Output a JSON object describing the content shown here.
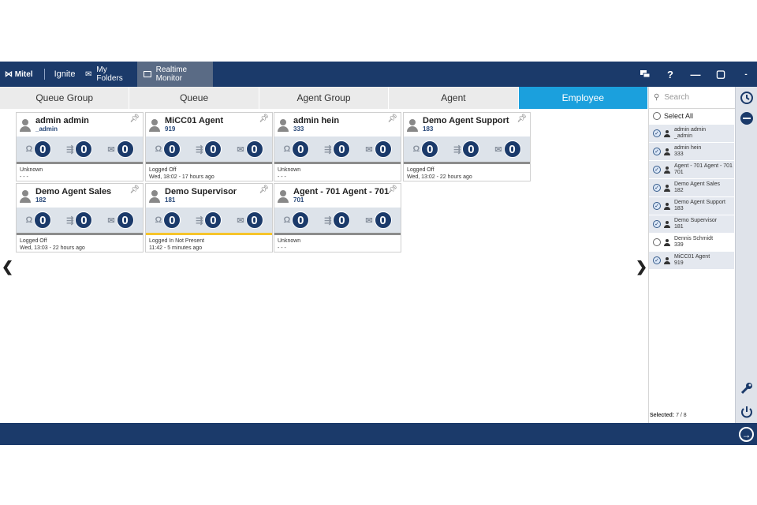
{
  "topbar": {
    "logo": "⋈ Mitel",
    "product": "Ignite",
    "my_folders": "My Folders",
    "realtime_monitor": "Realtime Monitor",
    "chat_icon": "chat-icon",
    "help_label": "?",
    "minimize_label": "—",
    "maximize_label": "▢",
    "extra_label": "-"
  },
  "tabs": [
    "Queue Group",
    "Queue",
    "Agent Group",
    "Agent",
    "Employee"
  ],
  "active_tab": "Employee",
  "search": {
    "placeholder": "Search"
  },
  "select_all": "Select All",
  "employees": [
    {
      "line1": "admin admin",
      "line2": "_admin",
      "selected": true
    },
    {
      "line1": "admin hein",
      "line2": "333",
      "selected": true
    },
    {
      "line1": "Agent - 701 Agent - 701",
      "line2": "701",
      "selected": true
    },
    {
      "line1": "Demo Agent Sales",
      "line2": "182",
      "selected": true
    },
    {
      "line1": "Demo Agent Support",
      "line2": "183",
      "selected": true
    },
    {
      "line1": "Demo Supervisor",
      "line2": "181",
      "selected": true
    },
    {
      "line1": "Dennis Schmidt",
      "line2": "339",
      "selected": false
    },
    {
      "line1": "MiCC01 Agent",
      "line2": "919",
      "selected": true
    }
  ],
  "selected_count": {
    "label": "Selected:",
    "value": "7 / 8"
  },
  "cards": [
    {
      "name": "admin admin",
      "ext": "_admin",
      "calls": "0",
      "transfers": "0",
      "emails": "0",
      "status": "Unknown",
      "time": "- - -",
      "bar": "grey"
    },
    {
      "name": "MiCC01 Agent",
      "ext": "919",
      "calls": "0",
      "transfers": "0",
      "emails": "0",
      "status": "Logged Off",
      "time": "Wed, 18:02 - 17 hours ago",
      "bar": "grey"
    },
    {
      "name": "admin hein",
      "ext": "333",
      "calls": "0",
      "transfers": "0",
      "emails": "0",
      "status": "Unknown",
      "time": "- - -",
      "bar": "grey"
    },
    {
      "name": "Demo Agent Support",
      "ext": "183",
      "calls": "0",
      "transfers": "0",
      "emails": "0",
      "status": "Logged Off",
      "time": "Wed, 13:02 - 22 hours ago",
      "bar": "grey"
    },
    {
      "name": "Demo Agent Sales",
      "ext": "182",
      "calls": "0",
      "transfers": "0",
      "emails": "0",
      "status": "Logged Off",
      "time": "Wed, 13:03 - 22 hours ago",
      "bar": "grey"
    },
    {
      "name": "Demo Supervisor",
      "ext": "181",
      "calls": "0",
      "transfers": "0",
      "emails": "0",
      "status": "Logged In Not Present",
      "time": "11:42 - 5 minutes ago",
      "bar": "yellow"
    },
    {
      "name": "Agent - 701 Agent - 701",
      "ext": "701",
      "calls": "0",
      "transfers": "0",
      "emails": "0",
      "status": "Unknown",
      "time": "- - -",
      "bar": "grey"
    }
  ],
  "nav": {
    "prev": "❮",
    "next": "❯"
  },
  "colors": {
    "primary": "#1b3a6a",
    "accent": "#1ba0dd",
    "away": "#f6c42b"
  }
}
